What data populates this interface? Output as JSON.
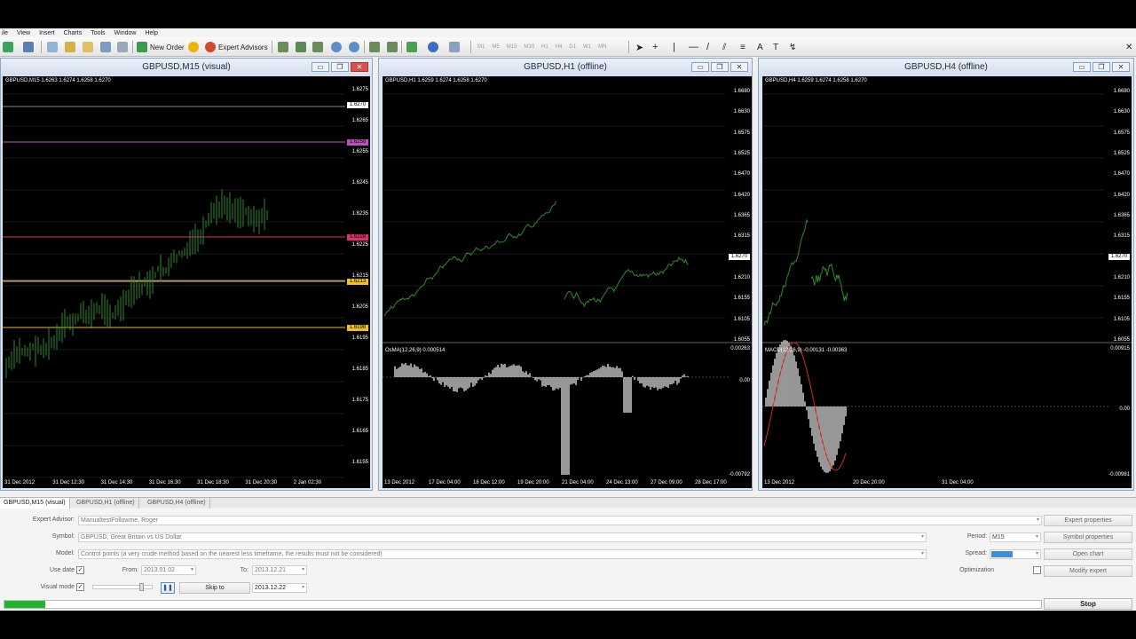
{
  "menu": [
    "ile",
    "View",
    "Insert",
    "Charts",
    "Tools",
    "Window",
    "Help"
  ],
  "toolbar": {
    "new_order": "New Order",
    "expert_advisors": "Expert Advisors",
    "timeframes": [
      "M1",
      "M5",
      "M15",
      "M30",
      "H1",
      "H4",
      "D1",
      "W1",
      "MN"
    ]
  },
  "windows": [
    {
      "title": "GBPUSD,M15 (visual)",
      "ohlc": "GBPUSD,M15  1.6263 1.6274 1.6258 1.6270",
      "price_labels": [
        "1.6275",
        "1.6265",
        "1.6255",
        "1.6245",
        "1.6235",
        "1.6225",
        "1.6215",
        "1.6205",
        "1.6195",
        "1.6185",
        "1.6175",
        "1.6165",
        "1.6155"
      ],
      "tags": [
        {
          "text": "1.6270",
          "color": "#ffffff"
        },
        {
          "text": "1.6258",
          "color": "#c04fc0"
        },
        {
          "text": "1.6228",
          "color": "#e0306a"
        },
        {
          "text": "1.6213",
          "color": "#f0c020"
        },
        {
          "text": "1.6198",
          "color": "#f0c020"
        }
      ],
      "time_labels": [
        "31 Dec 2012",
        "31 Dec 12:30",
        "31 Dec 14:30",
        "31 Dec 16:30",
        "31 Dec 18:30",
        "31 Dec 20:30",
        "2 Jan 02:30"
      ]
    },
    {
      "title": "GBPUSD,H1 (offline)",
      "ohlc": "GBPUSD,H1  1.6259 1.6274 1.6258 1.6270",
      "price_labels": [
        "1.6680",
        "1.6630",
        "1.6575",
        "1.6525",
        "1.6470",
        "1.6420",
        "1.6365",
        "1.6315",
        "1.6270",
        "1.6210",
        "1.6155",
        "1.6105",
        "1.6055"
      ],
      "indicator": {
        "label": "OsMA(12,26,9) 0.000514",
        "top": "0.00263",
        "mid": "0.00",
        "bottom": "-0.00792"
      },
      "time_labels": [
        "13 Dec 2012",
        "17 Dec 04:00",
        "18 Dec 12:00",
        "19 Dec 20:00",
        "21 Dec 04:00",
        "24 Dec 13:00",
        "27 Dec 09:00",
        "28 Dec 17:00"
      ]
    },
    {
      "title": "GBPUSD,H4 (offline)",
      "ohlc": "GBPUSD,H4  1.6259 1.6274 1.6258 1.6270",
      "price_labels": [
        "1.6680",
        "1.6630",
        "1.6575",
        "1.6525",
        "1.6470",
        "1.6420",
        "1.6365",
        "1.6315",
        "1.6270",
        "1.6210",
        "1.6155",
        "1.6105",
        "1.6055"
      ],
      "indicator": {
        "label": "MACD(12,26,9) -0.00131 -0.00363",
        "top": "0.00915",
        "mid": "0.00",
        "bottom": "-0.00981"
      },
      "time_labels": [
        "13 Dec 2012",
        "20 Dec 20:00",
        "31 Dec 04:00"
      ]
    }
  ],
  "tabs": [
    "GBPUSD,M15 (visual)",
    "GBPUSD,H1 (offline)",
    "GBPUSD,H4 (offline)"
  ],
  "tester": {
    "expert_advisor_label": "Expert Advisor:",
    "expert_advisor_value": "ManualtestFollowme, Roger",
    "symbol_label": "Symbol:",
    "symbol_value": "GBPUSD, Great Britain vs US Dollar",
    "model_label": "Model:",
    "model_value": "Control points (a very crude method based on the nearest less timeframe, the results must not be considered)",
    "use_date_label": "Use date",
    "from_label": "From:",
    "from_value": "2013.01.02",
    "to_label": "To:",
    "to_value": "2013.12.21",
    "visual_mode_label": "Visual mode",
    "skip_to_label": "Skip to",
    "skip_to_date": "2013.12.22",
    "period_label": "Period:",
    "period_value": "M15",
    "spread_label": "Spread:",
    "optimization_label": "Optimization",
    "buttons": {
      "expert_properties": "Expert properties",
      "symbol_properties": "Symbol properties",
      "open_chart": "Open chart",
      "modify_expert": "Modify expert"
    },
    "progress": 0.039,
    "stop": "Stop"
  }
}
